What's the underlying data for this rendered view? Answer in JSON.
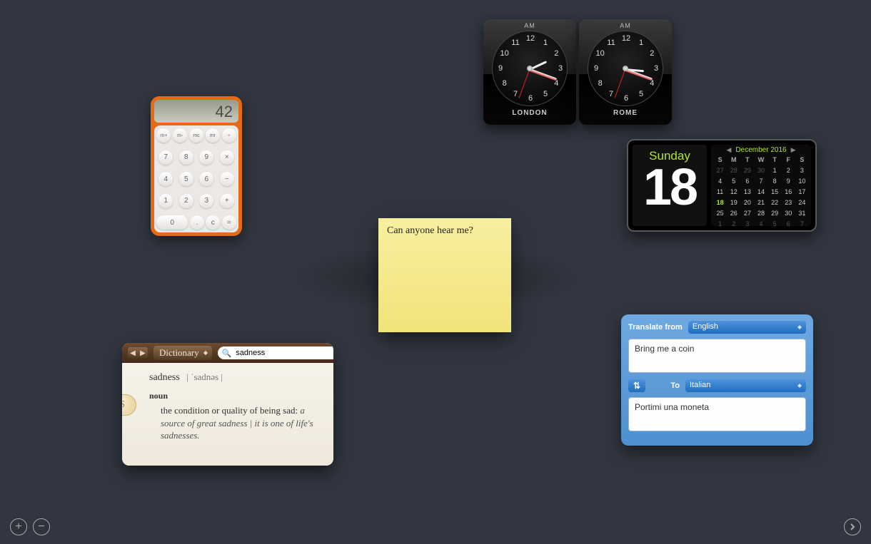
{
  "calculator": {
    "display": "42",
    "rows": [
      [
        "m+",
        "m-",
        "mc",
        "mr",
        "÷"
      ],
      [
        "7",
        "8",
        "9",
        "×"
      ],
      [
        "4",
        "5",
        "6",
        "−"
      ],
      [
        "1",
        "2",
        "3",
        "+"
      ],
      [
        "0",
        ".",
        "c",
        "="
      ]
    ]
  },
  "clocks": [
    {
      "city": "LONDON",
      "ampm": "AM",
      "hour_deg": -25,
      "min_deg": 20,
      "sec_deg": 110
    },
    {
      "city": "ROME",
      "ampm": "AM",
      "hour_deg": 5,
      "min_deg": 20,
      "sec_deg": 110
    }
  ],
  "clock_numerals": [
    "12",
    "1",
    "2",
    "3",
    "4",
    "5",
    "6",
    "7",
    "8",
    "9",
    "10",
    "11"
  ],
  "sticky": {
    "text": "Can anyone hear me?"
  },
  "calendar": {
    "weekday": "Sunday",
    "date": "18",
    "month_label": "December 2016",
    "dow": [
      "S",
      "M",
      "T",
      "W",
      "T",
      "F",
      "S"
    ],
    "lead_dim": [
      "27",
      "28",
      "29",
      "30"
    ],
    "days": [
      "1",
      "2",
      "3",
      "4",
      "5",
      "6",
      "7",
      "8",
      "9",
      "10",
      "11",
      "12",
      "13",
      "14",
      "15",
      "16",
      "17",
      "18",
      "19",
      "20",
      "21",
      "22",
      "23",
      "24",
      "25",
      "26",
      "27",
      "28",
      "29",
      "30",
      "31"
    ],
    "trail_dim": [
      "1",
      "2",
      "3",
      "4",
      "5",
      "6",
      "7"
    ],
    "today": "18"
  },
  "dictionary": {
    "source_label": "Dictionary",
    "query": "sadness",
    "headword": "sadness",
    "pronunciation": "| ˈsadnəs |",
    "pos": "noun",
    "definition": "the condition or quality of being sad: ",
    "example": "a source of great sadness | it is one of life's sadnesses.",
    "thumb": "S"
  },
  "translator": {
    "from_label": "Translate from",
    "from_lang": "English",
    "to_label": "To",
    "to_lang": "Italian",
    "source_text": "Bring me a coin",
    "target_text": "Portimi una moneta",
    "swap_glyph": "⇅"
  },
  "dash": {
    "add": "+",
    "remove": "−"
  }
}
